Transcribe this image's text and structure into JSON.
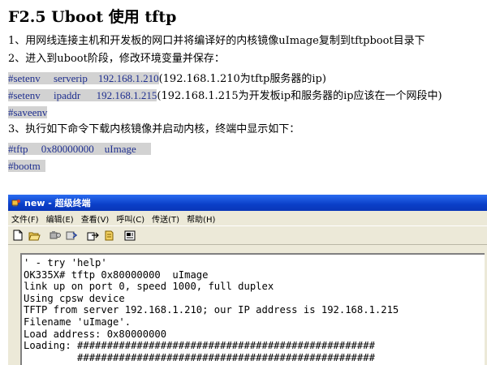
{
  "doc": {
    "title": "F2.5 Uboot 使用 tftp",
    "para1": "1、用网线连接主机和开发板的网口并将编译好的内核镜像uImage复制到tftpboot目录下",
    "para2": "2、进入到uboot阶段，修改环境变量并保存：",
    "cmd1": "#setenv     serverip    192.168.1.210",
    "cmd1_note": "(192.168.1.210为tftp服务器的ip)",
    "cmd2": "#setenv     ipaddr      192.168.1.215",
    "cmd2_note": "(192.168.1.215为开发板ip和服务器的ip应该在一个网段中)",
    "cmd3": "#saveenv",
    "para3": "3、执行如下命令下载内核镜像并启动内核，终端中显示如下：",
    "cmd4": "#tftp     0x80000000    uImage",
    "cmd5": "#bootm"
  },
  "window": {
    "title": "new - 超级终端",
    "menu": [
      "文件(F)",
      "编辑(E)",
      "查看(V)",
      "呼叫(C)",
      "传送(T)",
      "帮助(H)"
    ],
    "toolbar_icons": [
      "new-icon",
      "open-icon",
      "disconnect-icon",
      "properties-icon",
      "send-icon",
      "receive-icon",
      "settings-icon"
    ],
    "accent": "#0a3fc8"
  },
  "terminal": {
    "lines": [
      "' - try 'help'",
      "OK335X# tftp 0x80000000  uImage",
      "link up on port 0, speed 1000, full duplex",
      "Using cpsw device",
      "TFTP from server 192.168.1.210; our IP address is 192.168.1.215",
      "Filename 'uImage'.",
      "Load address: 0x80000000",
      "Loading: ##################################################",
      "         ##################################################",
      "         ##################################################"
    ]
  }
}
